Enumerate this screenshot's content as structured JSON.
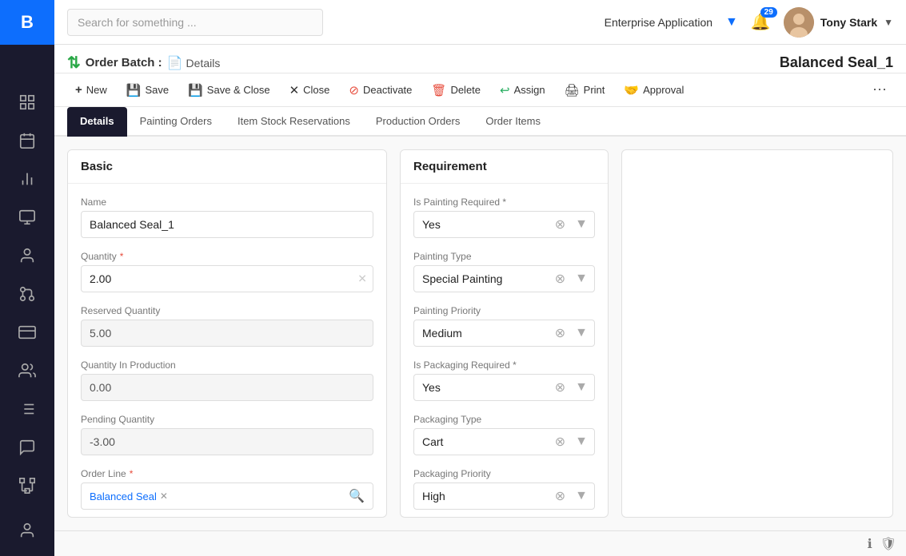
{
  "sidebar": {
    "logo": "B",
    "items": [
      {
        "name": "dashboard-item",
        "icon": "grid"
      },
      {
        "name": "calendar-item",
        "icon": "calendar"
      },
      {
        "name": "chart-item",
        "icon": "bar-chart"
      },
      {
        "name": "monitor-item",
        "icon": "monitor"
      },
      {
        "name": "user-item",
        "icon": "user"
      },
      {
        "name": "git-item",
        "icon": "git"
      },
      {
        "name": "card-item",
        "icon": "credit-card"
      },
      {
        "name": "group-item",
        "icon": "users"
      },
      {
        "name": "list-item",
        "icon": "list"
      },
      {
        "name": "chat-item",
        "icon": "message"
      },
      {
        "name": "network-item",
        "icon": "network"
      },
      {
        "name": "person-bottom",
        "icon": "user-circle"
      }
    ]
  },
  "topbar": {
    "search_placeholder": "Search for something ...",
    "enterprise_label": "Enterprise Application",
    "notification_count": "29",
    "user_name": "Tony Stark"
  },
  "page_header": {
    "breadcrumb_icon": "⇅",
    "order_batch_label": "Order Batch :",
    "details_label": "Details",
    "page_title": "Balanced Seal_1"
  },
  "toolbar": {
    "buttons": [
      {
        "name": "new-button",
        "label": "New",
        "icon": "+"
      },
      {
        "name": "save-button",
        "label": "Save",
        "icon": "💾"
      },
      {
        "name": "save-close-button",
        "label": "Save & Close",
        "icon": "💾"
      },
      {
        "name": "close-button",
        "label": "Close",
        "icon": "✕"
      },
      {
        "name": "deactivate-button",
        "label": "Deactivate",
        "icon": "⊘"
      },
      {
        "name": "delete-button",
        "label": "Delete",
        "icon": "🗑"
      },
      {
        "name": "assign-button",
        "label": "Assign",
        "icon": "↩"
      },
      {
        "name": "print-button",
        "label": "Print",
        "icon": "🖨"
      },
      {
        "name": "approval-button",
        "label": "Approval",
        "icon": "🤝"
      }
    ]
  },
  "tabs": [
    {
      "name": "details-tab",
      "label": "Details",
      "active": true
    },
    {
      "name": "painting-orders-tab",
      "label": "Painting Orders",
      "active": false
    },
    {
      "name": "item-stock-tab",
      "label": "Item Stock Reservations",
      "active": false
    },
    {
      "name": "production-orders-tab",
      "label": "Production Orders",
      "active": false
    },
    {
      "name": "order-items-tab",
      "label": "Order Items",
      "active": false
    }
  ],
  "basic_section": {
    "title": "Basic",
    "name_label": "Name",
    "name_value": "Balanced Seal_1",
    "quantity_label": "Quantity",
    "quantity_required": true,
    "quantity_value": "2.00",
    "reserved_quantity_label": "Reserved Quantity",
    "reserved_quantity_value": "5.00",
    "quantity_in_production_label": "Quantity In Production",
    "quantity_in_production_value": "0.00",
    "pending_quantity_label": "Pending Quantity",
    "pending_quantity_value": "-3.00",
    "order_line_label": "Order Line",
    "order_line_required": true,
    "order_line_tag": "Balanced Seal"
  },
  "requirement_section": {
    "title": "Requirement",
    "is_painting_required_label": "Is Painting Required *",
    "is_painting_required_value": "Yes",
    "painting_type_label": "Painting Type",
    "painting_type_value": "Special Painting",
    "painting_priority_label": "Painting Priority",
    "painting_priority_value": "Medium",
    "is_packaging_required_label": "Is Packaging Required *",
    "is_packaging_required_value": "Yes",
    "packaging_type_label": "Packaging Type",
    "packaging_type_value": "Cart",
    "packaging_priority_label": "Packaging Priority",
    "packaging_priority_value": "High"
  }
}
